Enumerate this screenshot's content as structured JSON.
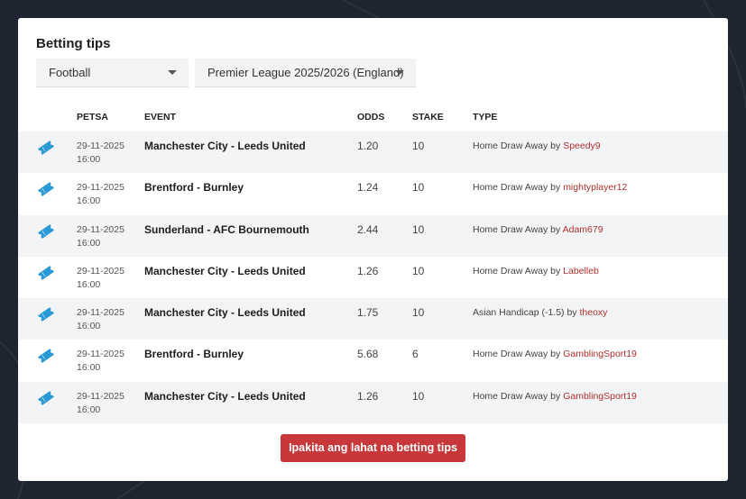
{
  "widget": {
    "title": "Betting tips"
  },
  "filters": {
    "sport": "Football",
    "league": "Premier League 2025/2026 (England)"
  },
  "table": {
    "headers": {
      "date": "PETSA",
      "event": "EVENT",
      "odds": "ODDS",
      "stake": "STAKE",
      "type": "TYPE"
    },
    "rows": [
      {
        "icon": "ticket-icon",
        "date": "29-11-2025",
        "time": "16:00",
        "event": "Manchester City - Leeds United",
        "odds": "1.20",
        "stake": "10",
        "type": "Home Draw Away",
        "by": "by",
        "user": "Speedy9"
      },
      {
        "icon": "ticket-icon",
        "date": "29-11-2025",
        "time": "16:00",
        "event": "Brentford - Burnley",
        "odds": "1.24",
        "stake": "10",
        "type": "Home Draw Away",
        "by": "by",
        "user": "mightyplayer12"
      },
      {
        "icon": "ticket-icon",
        "date": "29-11-2025",
        "time": "16:00",
        "event": "Sunderland - AFC Bournemouth",
        "odds": "2.44",
        "stake": "10",
        "type": "Home Draw Away",
        "by": "by",
        "user": "Adam679"
      },
      {
        "icon": "ticket-icon",
        "date": "29-11-2025",
        "time": "16:00",
        "event": "Manchester City - Leeds United",
        "odds": "1.26",
        "stake": "10",
        "type": "Home Draw Away",
        "by": "by",
        "user": "Labelleb"
      },
      {
        "icon": "ticket-icon",
        "date": "29-11-2025",
        "time": "16:00",
        "event": "Manchester City - Leeds United",
        "odds": "1.75",
        "stake": "10",
        "type": "Asian Handicap (-1.5)",
        "by": "by",
        "user": "theoxy"
      },
      {
        "icon": "ticket-icon",
        "date": "29-11-2025",
        "time": "16:00",
        "event": "Brentford - Burnley",
        "odds": "5.68",
        "stake": "6",
        "type": "Home Draw Away",
        "by": "by",
        "user": "GamblingSport19"
      },
      {
        "icon": "ticket-icon",
        "date": "29-11-2025",
        "time": "16:00",
        "event": "Manchester City - Leeds United",
        "odds": "1.26",
        "stake": "10",
        "type": "Home Draw Away",
        "by": "by",
        "user": "GamblingSport19"
      }
    ]
  },
  "footer": {
    "button_label": "Ipakita ang lahat na betting tips"
  },
  "colors": {
    "accent": "#c8383a",
    "icon": "#2a9ad6",
    "user_link": "#b0302c",
    "page_bg": "#1f2530"
  }
}
